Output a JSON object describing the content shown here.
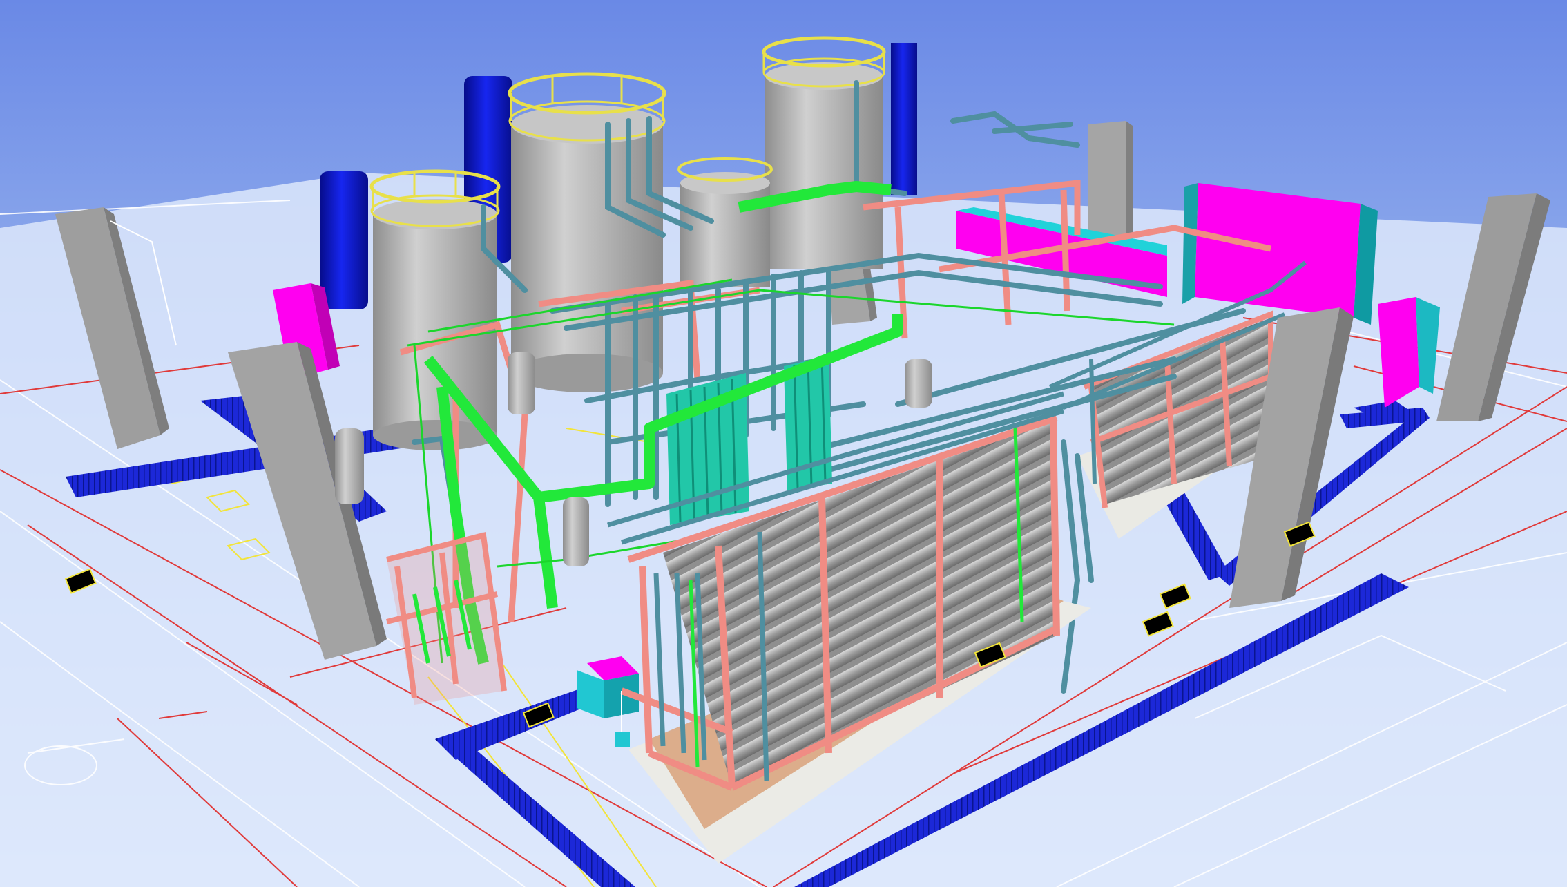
{
  "viewport": {
    "view_label": "",
    "colors": {
      "sky_top": "#6a89e6",
      "sky_bottom": "#dde9fb",
      "floor": "#e4edfb",
      "grid_red": "#e03a3a",
      "grid_white": "#ffffff",
      "trench_blue": "#1c28d8",
      "trench_grate": "#0a1a9a",
      "column_gray": "#a9a9a9",
      "tank_gray": "#b5b5b5",
      "tank_blue": "#0b14c8",
      "railing_yellow": "#e8e04a",
      "frame_salmon": "#f08c84",
      "pipe_teal": "#4f8fa0",
      "pipe_green": "#22e83a",
      "vessel_teal": "#22c7a8",
      "panel_magenta": "#ff00f0",
      "panel_cyan": "#1fd0d8",
      "skid_base": "#e9e9e4",
      "skid_wood": "#d9a27a",
      "membrane_gray": "#9b9b9b"
    },
    "marker_icons": [
      "marker-tag-icon",
      "marker-tag-icon",
      "marker-tag-icon",
      "marker-tag-icon",
      "marker-tag-icon",
      "marker-tag-icon"
    ]
  }
}
